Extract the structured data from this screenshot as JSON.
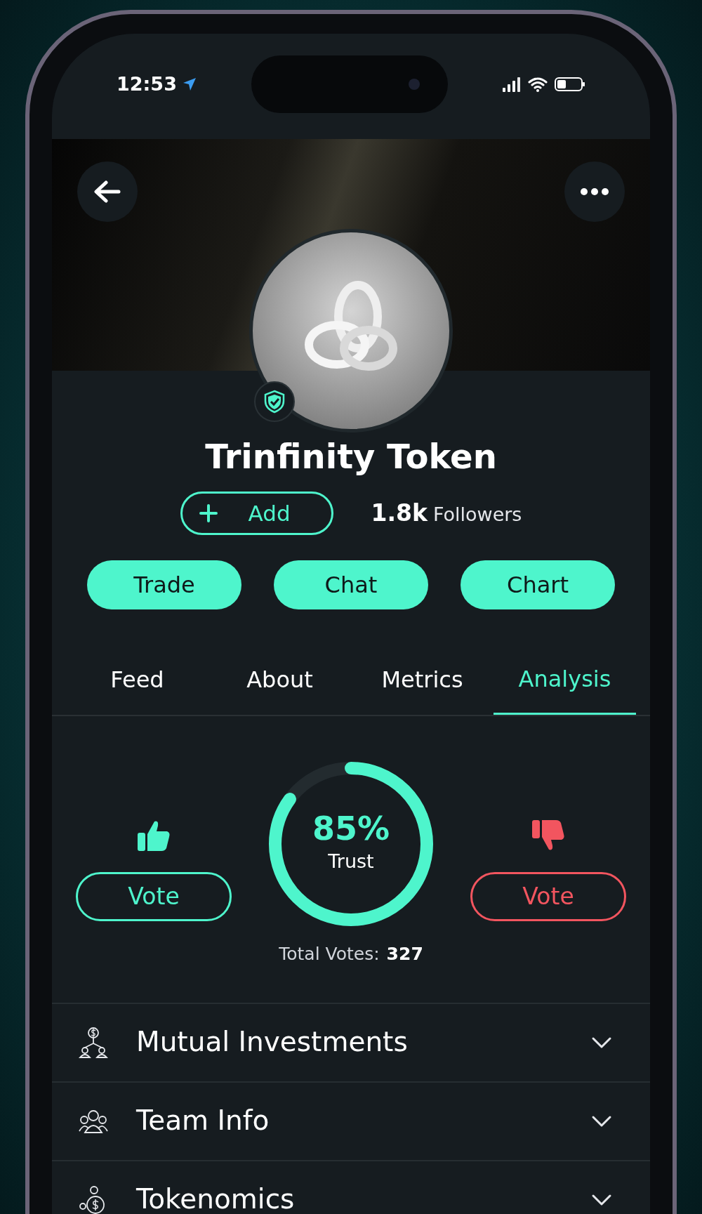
{
  "status_bar": {
    "time": "12:53"
  },
  "profile": {
    "name": "Trinfinity Token",
    "verified": true,
    "add_label": "Add",
    "followers_count": "1.8k",
    "followers_label": "Followers"
  },
  "actions": [
    "Trade",
    "Chat",
    "Chart"
  ],
  "tabs": [
    {
      "label": "Feed",
      "selected": false
    },
    {
      "label": "About",
      "selected": false
    },
    {
      "label": "Metrics",
      "selected": false
    },
    {
      "label": "Analysis",
      "selected": true
    }
  ],
  "trust": {
    "upvote_label": "Vote",
    "downvote_label": "Vote",
    "percent": "85%",
    "label": "Trust",
    "level": 0.85,
    "total_label": "Total Votes:",
    "total": "327"
  },
  "sections": [
    {
      "kind": "investments",
      "title": "Mutual Investments",
      "expanded": false
    },
    {
      "kind": "team",
      "title": "Team Info",
      "expanded": false
    },
    {
      "kind": "tokenomics",
      "title": "Tokenomics",
      "expanded": false
    }
  ]
}
